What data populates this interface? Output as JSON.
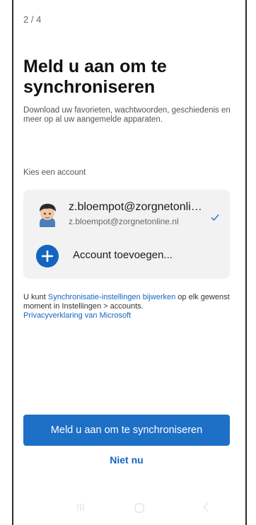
{
  "header": {
    "step": "2 / 4"
  },
  "main": {
    "title": "Meld u aan om te synchroniseren",
    "subtitle": "Download uw favorieten, wachtwoorden, geschiedenis en meer op al uw aangemelde apparaten.",
    "choose_label": "Kies een account"
  },
  "account": {
    "name": "z.bloempot@zorgnetonline.nl",
    "email": "z.bloempot@zorgnetonline.nl",
    "icon": "check-icon",
    "selected_color": "#1e6fc6"
  },
  "add_account": {
    "label": "Account toevoegen...",
    "icon": "plus-icon"
  },
  "info": {
    "prefix": "U kunt ",
    "sync_link": "Synchronisatie-instellingen bijwerken",
    "middle": " op elk gewenst moment in Instellingen > accounts.",
    "privacy_link": "Privacyverklaring van Microsoft"
  },
  "actions": {
    "primary_label": "Meld u aan om te synchroniseren",
    "secondary_label": "Niet nu"
  },
  "colors": {
    "accent": "#1e6fc6",
    "link": "#1565c0",
    "card_bg": "#f2f2f2"
  },
  "navbar": {
    "icons": [
      "recents-icon",
      "home-icon",
      "back-icon"
    ]
  }
}
